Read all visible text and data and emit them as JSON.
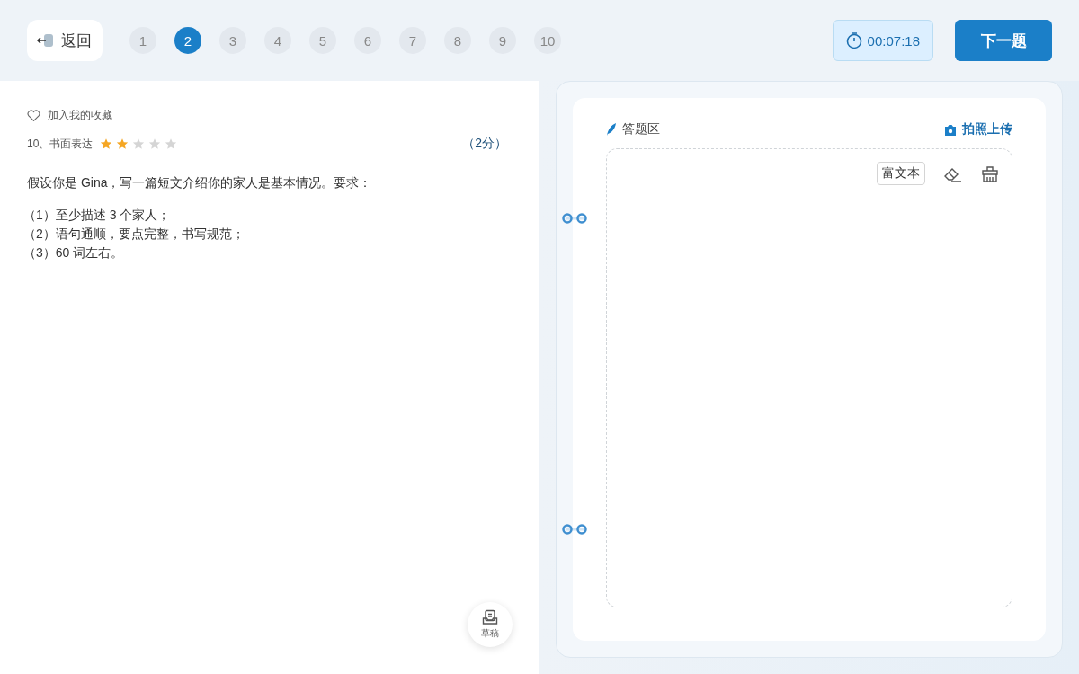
{
  "header": {
    "back_label": "返回",
    "questions": [
      {
        "label": "1",
        "selected": false
      },
      {
        "label": "2",
        "selected": true
      },
      {
        "label": "3",
        "selected": false
      },
      {
        "label": "4",
        "selected": false
      },
      {
        "label": "5",
        "selected": false
      },
      {
        "label": "6",
        "selected": false
      },
      {
        "label": "7",
        "selected": false
      },
      {
        "label": "8",
        "selected": false
      },
      {
        "label": "9",
        "selected": false
      },
      {
        "label": "10",
        "selected": false
      }
    ],
    "timer": "00:07:18",
    "next_label": "下一题"
  },
  "question": {
    "favorite_label": "加入我的收藏",
    "title": "10、书面表达",
    "stars": 2,
    "score": "（2分）",
    "prompt": "假设你是 Gina，写一篇短文介绍你的家人是基本情况。要求：",
    "requirements": [
      "（1）至少描述 3 个家人；",
      "（2）语句通顺，要点完整，书写规范；",
      "（3）60 词左右。"
    ],
    "draft_label": "草稿"
  },
  "answer": {
    "title": "答题区",
    "upload_label": "拍照上传",
    "rich_text_label": "富文本"
  }
}
